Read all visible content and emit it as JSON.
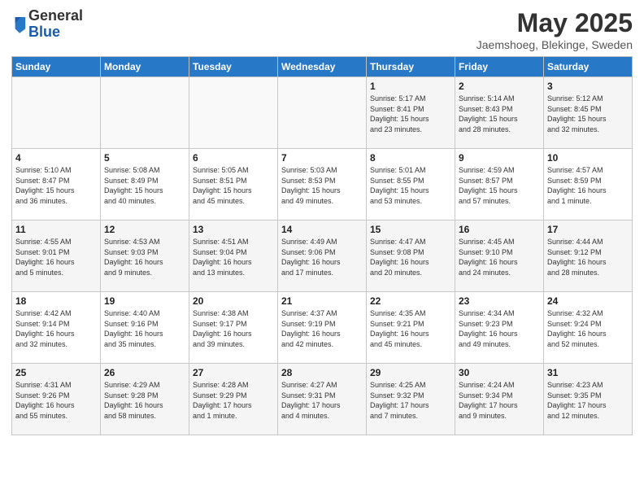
{
  "logo": {
    "general": "General",
    "blue": "Blue"
  },
  "header": {
    "title": "May 2025",
    "subtitle": "Jaemshoeg, Blekinge, Sweden"
  },
  "weekdays": [
    "Sunday",
    "Monday",
    "Tuesday",
    "Wednesday",
    "Thursday",
    "Friday",
    "Saturday"
  ],
  "weeks": [
    [
      {
        "day": "",
        "detail": ""
      },
      {
        "day": "",
        "detail": ""
      },
      {
        "day": "",
        "detail": ""
      },
      {
        "day": "",
        "detail": ""
      },
      {
        "day": "1",
        "detail": "Sunrise: 5:17 AM\nSunset: 8:41 PM\nDaylight: 15 hours\nand 23 minutes."
      },
      {
        "day": "2",
        "detail": "Sunrise: 5:14 AM\nSunset: 8:43 PM\nDaylight: 15 hours\nand 28 minutes."
      },
      {
        "day": "3",
        "detail": "Sunrise: 5:12 AM\nSunset: 8:45 PM\nDaylight: 15 hours\nand 32 minutes."
      }
    ],
    [
      {
        "day": "4",
        "detail": "Sunrise: 5:10 AM\nSunset: 8:47 PM\nDaylight: 15 hours\nand 36 minutes."
      },
      {
        "day": "5",
        "detail": "Sunrise: 5:08 AM\nSunset: 8:49 PM\nDaylight: 15 hours\nand 40 minutes."
      },
      {
        "day": "6",
        "detail": "Sunrise: 5:05 AM\nSunset: 8:51 PM\nDaylight: 15 hours\nand 45 minutes."
      },
      {
        "day": "7",
        "detail": "Sunrise: 5:03 AM\nSunset: 8:53 PM\nDaylight: 15 hours\nand 49 minutes."
      },
      {
        "day": "8",
        "detail": "Sunrise: 5:01 AM\nSunset: 8:55 PM\nDaylight: 15 hours\nand 53 minutes."
      },
      {
        "day": "9",
        "detail": "Sunrise: 4:59 AM\nSunset: 8:57 PM\nDaylight: 15 hours\nand 57 minutes."
      },
      {
        "day": "10",
        "detail": "Sunrise: 4:57 AM\nSunset: 8:59 PM\nDaylight: 16 hours\nand 1 minute."
      }
    ],
    [
      {
        "day": "11",
        "detail": "Sunrise: 4:55 AM\nSunset: 9:01 PM\nDaylight: 16 hours\nand 5 minutes."
      },
      {
        "day": "12",
        "detail": "Sunrise: 4:53 AM\nSunset: 9:03 PM\nDaylight: 16 hours\nand 9 minutes."
      },
      {
        "day": "13",
        "detail": "Sunrise: 4:51 AM\nSunset: 9:04 PM\nDaylight: 16 hours\nand 13 minutes."
      },
      {
        "day": "14",
        "detail": "Sunrise: 4:49 AM\nSunset: 9:06 PM\nDaylight: 16 hours\nand 17 minutes."
      },
      {
        "day": "15",
        "detail": "Sunrise: 4:47 AM\nSunset: 9:08 PM\nDaylight: 16 hours\nand 20 minutes."
      },
      {
        "day": "16",
        "detail": "Sunrise: 4:45 AM\nSunset: 9:10 PM\nDaylight: 16 hours\nand 24 minutes."
      },
      {
        "day": "17",
        "detail": "Sunrise: 4:44 AM\nSunset: 9:12 PM\nDaylight: 16 hours\nand 28 minutes."
      }
    ],
    [
      {
        "day": "18",
        "detail": "Sunrise: 4:42 AM\nSunset: 9:14 PM\nDaylight: 16 hours\nand 32 minutes."
      },
      {
        "day": "19",
        "detail": "Sunrise: 4:40 AM\nSunset: 9:16 PM\nDaylight: 16 hours\nand 35 minutes."
      },
      {
        "day": "20",
        "detail": "Sunrise: 4:38 AM\nSunset: 9:17 PM\nDaylight: 16 hours\nand 39 minutes."
      },
      {
        "day": "21",
        "detail": "Sunrise: 4:37 AM\nSunset: 9:19 PM\nDaylight: 16 hours\nand 42 minutes."
      },
      {
        "day": "22",
        "detail": "Sunrise: 4:35 AM\nSunset: 9:21 PM\nDaylight: 16 hours\nand 45 minutes."
      },
      {
        "day": "23",
        "detail": "Sunrise: 4:34 AM\nSunset: 9:23 PM\nDaylight: 16 hours\nand 49 minutes."
      },
      {
        "day": "24",
        "detail": "Sunrise: 4:32 AM\nSunset: 9:24 PM\nDaylight: 16 hours\nand 52 minutes."
      }
    ],
    [
      {
        "day": "25",
        "detail": "Sunrise: 4:31 AM\nSunset: 9:26 PM\nDaylight: 16 hours\nand 55 minutes."
      },
      {
        "day": "26",
        "detail": "Sunrise: 4:29 AM\nSunset: 9:28 PM\nDaylight: 16 hours\nand 58 minutes."
      },
      {
        "day": "27",
        "detail": "Sunrise: 4:28 AM\nSunset: 9:29 PM\nDaylight: 17 hours\nand 1 minute."
      },
      {
        "day": "28",
        "detail": "Sunrise: 4:27 AM\nSunset: 9:31 PM\nDaylight: 17 hours\nand 4 minutes."
      },
      {
        "day": "29",
        "detail": "Sunrise: 4:25 AM\nSunset: 9:32 PM\nDaylight: 17 hours\nand 7 minutes."
      },
      {
        "day": "30",
        "detail": "Sunrise: 4:24 AM\nSunset: 9:34 PM\nDaylight: 17 hours\nand 9 minutes."
      },
      {
        "day": "31",
        "detail": "Sunrise: 4:23 AM\nSunset: 9:35 PM\nDaylight: 17 hours\nand 12 minutes."
      }
    ]
  ]
}
